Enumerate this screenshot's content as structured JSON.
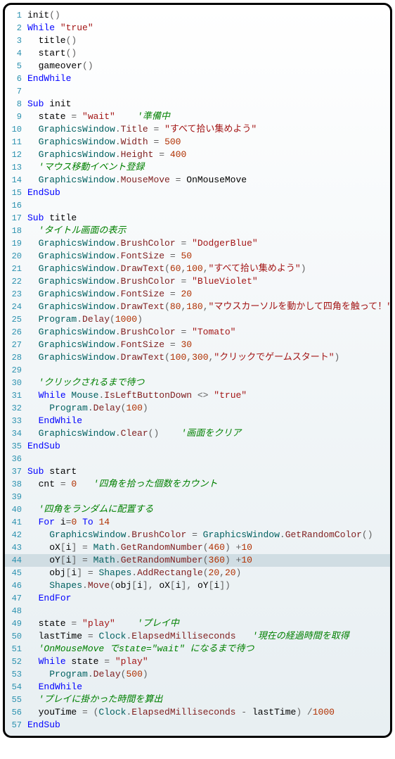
{
  "lines": [
    {
      "n": 1,
      "hl": false,
      "tokens": [
        [
          "id",
          "init"
        ],
        [
          "op",
          "()"
        ]
      ]
    },
    {
      "n": 2,
      "hl": false,
      "tokens": [
        [
          "kw",
          "While "
        ],
        [
          "str",
          "\"true\""
        ]
      ]
    },
    {
      "n": 3,
      "hl": false,
      "tokens": [
        [
          "id",
          "  title"
        ],
        [
          "op",
          "()"
        ]
      ]
    },
    {
      "n": 4,
      "hl": false,
      "tokens": [
        [
          "id",
          "  start"
        ],
        [
          "op",
          "()"
        ]
      ]
    },
    {
      "n": 5,
      "hl": false,
      "tokens": [
        [
          "id",
          "  gameover"
        ],
        [
          "op",
          "()"
        ]
      ]
    },
    {
      "n": 6,
      "hl": false,
      "tokens": [
        [
          "kw",
          "EndWhile"
        ]
      ]
    },
    {
      "n": 7,
      "hl": false,
      "tokens": []
    },
    {
      "n": 8,
      "hl": false,
      "tokens": [
        [
          "kw",
          "Sub "
        ],
        [
          "id",
          "init"
        ]
      ]
    },
    {
      "n": 9,
      "hl": false,
      "tokens": [
        [
          "id",
          "  state "
        ],
        [
          "op",
          "= "
        ],
        [
          "str",
          "\"wait\""
        ],
        [
          "id",
          "    "
        ],
        [
          "cmt",
          "'準備中"
        ]
      ]
    },
    {
      "n": 10,
      "hl": false,
      "tokens": [
        [
          "id",
          "  "
        ],
        [
          "cls",
          "GraphicsWindow"
        ],
        [
          "op",
          "."
        ],
        [
          "fn",
          "Title"
        ],
        [
          "op",
          " = "
        ],
        [
          "str",
          "\"すべて拾い集めよう\""
        ]
      ]
    },
    {
      "n": 11,
      "hl": false,
      "tokens": [
        [
          "id",
          "  "
        ],
        [
          "cls",
          "GraphicsWindow"
        ],
        [
          "op",
          "."
        ],
        [
          "fn",
          "Width"
        ],
        [
          "op",
          " = "
        ],
        [
          "num",
          "500"
        ]
      ]
    },
    {
      "n": 12,
      "hl": false,
      "tokens": [
        [
          "id",
          "  "
        ],
        [
          "cls",
          "GraphicsWindow"
        ],
        [
          "op",
          "."
        ],
        [
          "fn",
          "Height"
        ],
        [
          "op",
          " = "
        ],
        [
          "num",
          "400"
        ]
      ]
    },
    {
      "n": 13,
      "hl": false,
      "tokens": [
        [
          "id",
          "  "
        ],
        [
          "cmt",
          "'マウス移動イベント登録"
        ]
      ]
    },
    {
      "n": 14,
      "hl": false,
      "tokens": [
        [
          "id",
          "  "
        ],
        [
          "cls",
          "GraphicsWindow"
        ],
        [
          "op",
          "."
        ],
        [
          "fn",
          "MouseMove"
        ],
        [
          "op",
          " = "
        ],
        [
          "id",
          "OnMouseMove"
        ]
      ]
    },
    {
      "n": 15,
      "hl": false,
      "tokens": [
        [
          "kw",
          "EndSub"
        ]
      ]
    },
    {
      "n": 16,
      "hl": false,
      "tokens": []
    },
    {
      "n": 17,
      "hl": false,
      "tokens": [
        [
          "kw",
          "Sub "
        ],
        [
          "id",
          "title"
        ]
      ]
    },
    {
      "n": 18,
      "hl": false,
      "tokens": [
        [
          "id",
          "  "
        ],
        [
          "cmt",
          "'タイトル画面の表示"
        ]
      ]
    },
    {
      "n": 19,
      "hl": false,
      "tokens": [
        [
          "id",
          "  "
        ],
        [
          "cls",
          "GraphicsWindow"
        ],
        [
          "op",
          "."
        ],
        [
          "fn",
          "BrushColor"
        ],
        [
          "op",
          " = "
        ],
        [
          "str",
          "\"DodgerBlue\""
        ]
      ]
    },
    {
      "n": 20,
      "hl": false,
      "tokens": [
        [
          "id",
          "  "
        ],
        [
          "cls",
          "GraphicsWindow"
        ],
        [
          "op",
          "."
        ],
        [
          "fn",
          "FontSize"
        ],
        [
          "op",
          " = "
        ],
        [
          "num",
          "50"
        ]
      ]
    },
    {
      "n": 21,
      "hl": false,
      "tokens": [
        [
          "id",
          "  "
        ],
        [
          "cls",
          "GraphicsWindow"
        ],
        [
          "op",
          "."
        ],
        [
          "fn",
          "DrawText"
        ],
        [
          "op",
          "("
        ],
        [
          "num",
          "60"
        ],
        [
          "op",
          ","
        ],
        [
          "num",
          "100"
        ],
        [
          "op",
          ","
        ],
        [
          "str",
          "\"すべて拾い集めよう\""
        ],
        [
          "op",
          ")"
        ]
      ]
    },
    {
      "n": 22,
      "hl": false,
      "tokens": [
        [
          "id",
          "  "
        ],
        [
          "cls",
          "GraphicsWindow"
        ],
        [
          "op",
          "."
        ],
        [
          "fn",
          "BrushColor"
        ],
        [
          "op",
          " = "
        ],
        [
          "str",
          "\"BlueViolet\""
        ]
      ]
    },
    {
      "n": 23,
      "hl": false,
      "tokens": [
        [
          "id",
          "  "
        ],
        [
          "cls",
          "GraphicsWindow"
        ],
        [
          "op",
          "."
        ],
        [
          "fn",
          "FontSize"
        ],
        [
          "op",
          " = "
        ],
        [
          "num",
          "20"
        ]
      ]
    },
    {
      "n": 24,
      "hl": false,
      "tokens": [
        [
          "id",
          "  "
        ],
        [
          "cls",
          "GraphicsWindow"
        ],
        [
          "op",
          "."
        ],
        [
          "fn",
          "DrawText"
        ],
        [
          "op",
          "("
        ],
        [
          "num",
          "80"
        ],
        [
          "op",
          ","
        ],
        [
          "num",
          "180"
        ],
        [
          "op",
          ","
        ],
        [
          "str",
          "\"マウスカーソルを動かして四角を触って！\""
        ],
        [
          "op",
          ")"
        ]
      ]
    },
    {
      "n": 25,
      "hl": false,
      "tokens": [
        [
          "id",
          "  "
        ],
        [
          "cls",
          "Program"
        ],
        [
          "op",
          "."
        ],
        [
          "fn",
          "Delay"
        ],
        [
          "op",
          "("
        ],
        [
          "num",
          "1000"
        ],
        [
          "op",
          ")"
        ]
      ]
    },
    {
      "n": 26,
      "hl": false,
      "tokens": [
        [
          "id",
          "  "
        ],
        [
          "cls",
          "GraphicsWindow"
        ],
        [
          "op",
          "."
        ],
        [
          "fn",
          "BrushColor"
        ],
        [
          "op",
          " = "
        ],
        [
          "str",
          "\"Tomato\""
        ]
      ]
    },
    {
      "n": 27,
      "hl": false,
      "tokens": [
        [
          "id",
          "  "
        ],
        [
          "cls",
          "GraphicsWindow"
        ],
        [
          "op",
          "."
        ],
        [
          "fn",
          "FontSize"
        ],
        [
          "op",
          " = "
        ],
        [
          "num",
          "30"
        ]
      ]
    },
    {
      "n": 28,
      "hl": false,
      "tokens": [
        [
          "id",
          "  "
        ],
        [
          "cls",
          "GraphicsWindow"
        ],
        [
          "op",
          "."
        ],
        [
          "fn",
          "DrawText"
        ],
        [
          "op",
          "("
        ],
        [
          "num",
          "100"
        ],
        [
          "op",
          ","
        ],
        [
          "num",
          "300"
        ],
        [
          "op",
          ","
        ],
        [
          "str",
          "\"クリックでゲームスタート\""
        ],
        [
          "op",
          ")"
        ]
      ]
    },
    {
      "n": 29,
      "hl": false,
      "tokens": []
    },
    {
      "n": 30,
      "hl": false,
      "tokens": [
        [
          "id",
          "  "
        ],
        [
          "cmt",
          "'クリックされるまで待つ"
        ]
      ]
    },
    {
      "n": 31,
      "hl": false,
      "tokens": [
        [
          "id",
          "  "
        ],
        [
          "kw",
          "While "
        ],
        [
          "cls",
          "Mouse"
        ],
        [
          "op",
          "."
        ],
        [
          "fn",
          "IsLeftButtonDown"
        ],
        [
          "op",
          " <> "
        ],
        [
          "str",
          "\"true\""
        ]
      ]
    },
    {
      "n": 32,
      "hl": false,
      "tokens": [
        [
          "id",
          "    "
        ],
        [
          "cls",
          "Program"
        ],
        [
          "op",
          "."
        ],
        [
          "fn",
          "Delay"
        ],
        [
          "op",
          "("
        ],
        [
          "num",
          "100"
        ],
        [
          "op",
          ")"
        ]
      ]
    },
    {
      "n": 33,
      "hl": false,
      "tokens": [
        [
          "id",
          "  "
        ],
        [
          "kw",
          "EndWhile"
        ]
      ]
    },
    {
      "n": 34,
      "hl": false,
      "tokens": [
        [
          "id",
          "  "
        ],
        [
          "cls",
          "GraphicsWindow"
        ],
        [
          "op",
          "."
        ],
        [
          "fn",
          "Clear"
        ],
        [
          "op",
          "()    "
        ],
        [
          "cmt",
          "'画面をクリア"
        ]
      ]
    },
    {
      "n": 35,
      "hl": false,
      "tokens": [
        [
          "kw",
          "EndSub"
        ]
      ]
    },
    {
      "n": 36,
      "hl": false,
      "tokens": []
    },
    {
      "n": 37,
      "hl": false,
      "tokens": [
        [
          "kw",
          "Sub "
        ],
        [
          "id",
          "start"
        ]
      ]
    },
    {
      "n": 38,
      "hl": false,
      "tokens": [
        [
          "id",
          "  cnt "
        ],
        [
          "op",
          "= "
        ],
        [
          "num",
          "0"
        ],
        [
          "id",
          "   "
        ],
        [
          "cmt",
          "'四角を拾った個数をカウント"
        ]
      ]
    },
    {
      "n": 39,
      "hl": false,
      "tokens": []
    },
    {
      "n": 40,
      "hl": false,
      "tokens": [
        [
          "id",
          "  "
        ],
        [
          "cmt",
          "'四角をランダムに配置する"
        ]
      ]
    },
    {
      "n": 41,
      "hl": false,
      "tokens": [
        [
          "id",
          "  "
        ],
        [
          "kw",
          "For "
        ],
        [
          "id",
          "i"
        ],
        [
          "op",
          "="
        ],
        [
          "num",
          "0"
        ],
        [
          "kw",
          " To "
        ],
        [
          "num",
          "14"
        ]
      ]
    },
    {
      "n": 42,
      "hl": false,
      "tokens": [
        [
          "id",
          "    "
        ],
        [
          "cls",
          "GraphicsWindow"
        ],
        [
          "op",
          "."
        ],
        [
          "fn",
          "BrushColor"
        ],
        [
          "op",
          " = "
        ],
        [
          "cls",
          "GraphicsWindow"
        ],
        [
          "op",
          "."
        ],
        [
          "fn",
          "GetRandomColor"
        ],
        [
          "op",
          "()"
        ]
      ]
    },
    {
      "n": 43,
      "hl": false,
      "tokens": [
        [
          "id",
          "    oX"
        ],
        [
          "op",
          "["
        ],
        [
          "id",
          "i"
        ],
        [
          "op",
          "] = "
        ],
        [
          "cls",
          "Math"
        ],
        [
          "op",
          "."
        ],
        [
          "fn",
          "GetRandomNumber"
        ],
        [
          "op",
          "("
        ],
        [
          "num",
          "460"
        ],
        [
          "op",
          ") +"
        ],
        [
          "num",
          "10"
        ]
      ]
    },
    {
      "n": 44,
      "hl": true,
      "tokens": [
        [
          "id",
          "    oY"
        ],
        [
          "op",
          "["
        ],
        [
          "id",
          "i"
        ],
        [
          "op",
          "] = "
        ],
        [
          "cls",
          "Math"
        ],
        [
          "op",
          "."
        ],
        [
          "fn",
          "GetRandomNumber"
        ],
        [
          "op",
          "("
        ],
        [
          "num",
          "360"
        ],
        [
          "op",
          ") +"
        ],
        [
          "num",
          "10"
        ]
      ]
    },
    {
      "n": 45,
      "hl": false,
      "tokens": [
        [
          "id",
          "    obj"
        ],
        [
          "op",
          "["
        ],
        [
          "id",
          "i"
        ],
        [
          "op",
          "] = "
        ],
        [
          "cls",
          "Shapes"
        ],
        [
          "op",
          "."
        ],
        [
          "fn",
          "AddRectangle"
        ],
        [
          "op",
          "("
        ],
        [
          "num",
          "20"
        ],
        [
          "op",
          ","
        ],
        [
          "num",
          "20"
        ],
        [
          "op",
          ")"
        ]
      ]
    },
    {
      "n": 46,
      "hl": false,
      "tokens": [
        [
          "id",
          "    "
        ],
        [
          "cls",
          "Shapes"
        ],
        [
          "op",
          "."
        ],
        [
          "fn",
          "Move"
        ],
        [
          "op",
          "("
        ],
        [
          "id",
          "obj"
        ],
        [
          "op",
          "["
        ],
        [
          "id",
          "i"
        ],
        [
          "op",
          "], "
        ],
        [
          "id",
          "oX"
        ],
        [
          "op",
          "["
        ],
        [
          "id",
          "i"
        ],
        [
          "op",
          "], "
        ],
        [
          "id",
          "oY"
        ],
        [
          "op",
          "["
        ],
        [
          "id",
          "i"
        ],
        [
          "op",
          "])"
        ]
      ]
    },
    {
      "n": 47,
      "hl": false,
      "tokens": [
        [
          "id",
          "  "
        ],
        [
          "kw",
          "EndFor"
        ]
      ]
    },
    {
      "n": 48,
      "hl": false,
      "tokens": []
    },
    {
      "n": 49,
      "hl": false,
      "tokens": [
        [
          "id",
          "  state "
        ],
        [
          "op",
          "= "
        ],
        [
          "str",
          "\"play\""
        ],
        [
          "id",
          "    "
        ],
        [
          "cmt",
          "'プレイ中"
        ]
      ]
    },
    {
      "n": 50,
      "hl": false,
      "tokens": [
        [
          "id",
          "  lastTime "
        ],
        [
          "op",
          "= "
        ],
        [
          "cls",
          "Clock"
        ],
        [
          "op",
          "."
        ],
        [
          "fn",
          "ElapsedMilliseconds"
        ],
        [
          "id",
          "   "
        ],
        [
          "cmt",
          "'現在の経過時間を取得"
        ]
      ]
    },
    {
      "n": 51,
      "hl": false,
      "tokens": [
        [
          "id",
          "  "
        ],
        [
          "cmt",
          "'OnMouseMove でstate=\"wait\" になるまで待つ"
        ]
      ]
    },
    {
      "n": 52,
      "hl": false,
      "tokens": [
        [
          "id",
          "  "
        ],
        [
          "kw",
          "While "
        ],
        [
          "id",
          "state "
        ],
        [
          "op",
          "= "
        ],
        [
          "str",
          "\"play\""
        ]
      ]
    },
    {
      "n": 53,
      "hl": false,
      "tokens": [
        [
          "id",
          "    "
        ],
        [
          "cls",
          "Program"
        ],
        [
          "op",
          "."
        ],
        [
          "fn",
          "Delay"
        ],
        [
          "op",
          "("
        ],
        [
          "num",
          "500"
        ],
        [
          "op",
          ")"
        ]
      ]
    },
    {
      "n": 54,
      "hl": false,
      "tokens": [
        [
          "id",
          "  "
        ],
        [
          "kw",
          "EndWhile"
        ]
      ]
    },
    {
      "n": 55,
      "hl": false,
      "tokens": [
        [
          "id",
          "  "
        ],
        [
          "cmt",
          "'プレイに掛かった時間を算出"
        ]
      ]
    },
    {
      "n": 56,
      "hl": false,
      "tokens": [
        [
          "id",
          "  youTime "
        ],
        [
          "op",
          "= ("
        ],
        [
          "cls",
          "Clock"
        ],
        [
          "op",
          "."
        ],
        [
          "fn",
          "ElapsedMilliseconds"
        ],
        [
          "op",
          " - "
        ],
        [
          "id",
          "lastTime"
        ],
        [
          "op",
          ") /"
        ],
        [
          "num",
          "1000"
        ]
      ]
    },
    {
      "n": 57,
      "hl": false,
      "tokens": [
        [
          "kw",
          "EndSub"
        ]
      ]
    }
  ]
}
